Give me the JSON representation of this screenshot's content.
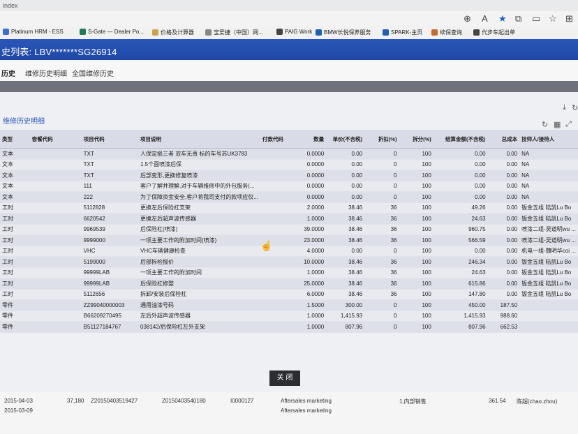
{
  "browser": {
    "tab_title": "index",
    "bookmarks": [
      {
        "label": "Platinum HRM - ESS",
        "color": "#3a6fd1"
      },
      {
        "label": "S-Gate — Dealer Po...",
        "color": "#1b7a5a"
      },
      {
        "label": "价格及计算器",
        "color": "#c9a54a"
      },
      {
        "label": "宝爱捷（中国）网...",
        "color": "#888888"
      },
      {
        "label": "PAIG Work",
        "color": "#444444"
      },
      {
        "label": "BMW长悦保养服务",
        "color": "#1c5fb3"
      },
      {
        "label": "SPARK-主页",
        "color": "#1c5fb3"
      },
      {
        "label": "续保查询",
        "color": "#c46a2a"
      },
      {
        "label": "代步车起出单",
        "color": "#444444"
      }
    ]
  },
  "header": {
    "title": "史列表: LBV*******SG26914"
  },
  "tabs": [
    {
      "label": "历史",
      "active": true
    },
    {
      "label": "维修历史明细",
      "active": false
    },
    {
      "label": "全国维修历史",
      "active": false
    }
  ],
  "modal": {
    "title": "维修历史明细",
    "close_label": "关 闭",
    "columns": [
      "类型",
      "套餐代码",
      "项目代码",
      "项目说明",
      "付款代码",
      "数量",
      "单价(不含税)",
      "折扣(%)",
      "拆分(%)",
      "结算金额(不含税)",
      "总成本",
      "技师人/接待人"
    ],
    "rows": [
      [
        "文本",
        "",
        "TXT",
        "人保定损三者 双车无责 标的车号苏UK3783",
        "",
        "0.0000",
        "0.00",
        "0",
        "100",
        "0.00",
        "0.00",
        "NA"
      ],
      [
        "文本",
        "",
        "TXT",
        "1.5个面喷漆后保",
        "",
        "0.0000",
        "0.00",
        "0",
        "100",
        "0.00",
        "0.00",
        "NA"
      ],
      [
        "文本",
        "",
        "TXT",
        "后部变形,更换修复喷漆",
        "",
        "0.0000",
        "0.00",
        "0",
        "100",
        "0.00",
        "0.00",
        "NA"
      ],
      [
        "文本",
        "",
        "111",
        "客户了解并理解,对于车辆维修中的外包服务(...",
        "",
        "0.0000",
        "0.00",
        "0",
        "100",
        "0.00",
        "0.00",
        "NA"
      ],
      [
        "文本",
        "",
        "222",
        "为了保障资金安全,客户将我司支付的款项应仅...",
        "",
        "0.0000",
        "0.00",
        "0",
        "100",
        "0.00",
        "0.00",
        "NA"
      ],
      [
        "工时",
        "",
        "5112828",
        "更换左后保险杠支架",
        "",
        "2.0000",
        "38.46",
        "36",
        "100",
        "49.26",
        "0.00",
        "钣金五组 陆凯Lu Bo"
      ],
      [
        "工时",
        "",
        "6620542",
        "更换左后超声波传感器",
        "",
        "1.0000",
        "38.46",
        "36",
        "100",
        "24.63",
        "0.00",
        "钣金五组 陆凯Lu Bo"
      ],
      [
        "工时",
        "",
        "9969539",
        "后保险杠(喷漆)",
        "",
        "39.0000",
        "38.46",
        "36",
        "100",
        "960.75",
        "0.00",
        "喷漆二组-吴道明wu ..."
      ],
      [
        "工时",
        "",
        "9999000",
        "一项主要工作的附加时间(喷漆)",
        "",
        "23.0000",
        "38.46",
        "36",
        "100",
        "566.59",
        "0.00",
        "喷漆二组-吴道明wu ..."
      ],
      [
        "工时",
        "",
        "VHC",
        "VHC车辆健康检查",
        "",
        "4.0000",
        "0.00",
        "0",
        "100",
        "0.00",
        "0.00",
        "机电一组-魏明华coi ..."
      ],
      [
        "工时",
        "",
        "5199000",
        "后部拆检报价",
        "",
        "10.0000",
        "38.46",
        "36",
        "100",
        "246.34",
        "0.00",
        "钣金五组 陆凯Lu Bo"
      ],
      [
        "工时",
        "",
        "99999LAB",
        "一项主要工作的附加时间",
        "",
        "1.0000",
        "38.46",
        "36",
        "100",
        "24.63",
        "0.00",
        "钣金五组 陆凯Lu Bo"
      ],
      [
        "工时",
        "",
        "99999LAB",
        "后保险杠修整",
        "",
        "25.0000",
        "38.46",
        "36",
        "100",
        "615.86",
        "0.00",
        "钣金五组 陆凯Lu Bo"
      ],
      [
        "工时",
        "",
        "5112656",
        "拆卸/安装后保险杠",
        "",
        "6.0000",
        "38.46",
        "36",
        "100",
        "147.80",
        "0.00",
        "钣金五组 陆凯Lu Bo"
      ],
      [
        "零件",
        "",
        "ZZ99040000003",
        "通用油漆号码",
        "",
        "1.5000",
        "300.00",
        "0",
        "100",
        "450.00",
        "187.50",
        ""
      ],
      [
        "零件",
        "",
        "B66209270495",
        "左后外超声波传感器",
        "",
        "1.0000",
        "1,415.93",
        "0",
        "100",
        "1,415.93",
        "988.60",
        ""
      ],
      [
        "零件",
        "",
        "B51127184767",
        "038142/后保险杠左外支架",
        "",
        "1.0000",
        "807.96",
        "0",
        "100",
        "807.96",
        "662.53",
        ""
      ]
    ]
  },
  "background_rows": [
    [
      "2015-04-03",
      "37,180",
      "Z20150403519427",
      "Z0150403540180",
      "I0000127",
      "Aftersales marketing",
      "",
      "1,内部销售",
      "",
      "361.54",
      "陈超(chao.zhou)"
    ],
    [
      "2015-03-09",
      "",
      "",
      "",
      "",
      "Aftersales marketing",
      "",
      "",
      "",
      "",
      ""
    ]
  ]
}
